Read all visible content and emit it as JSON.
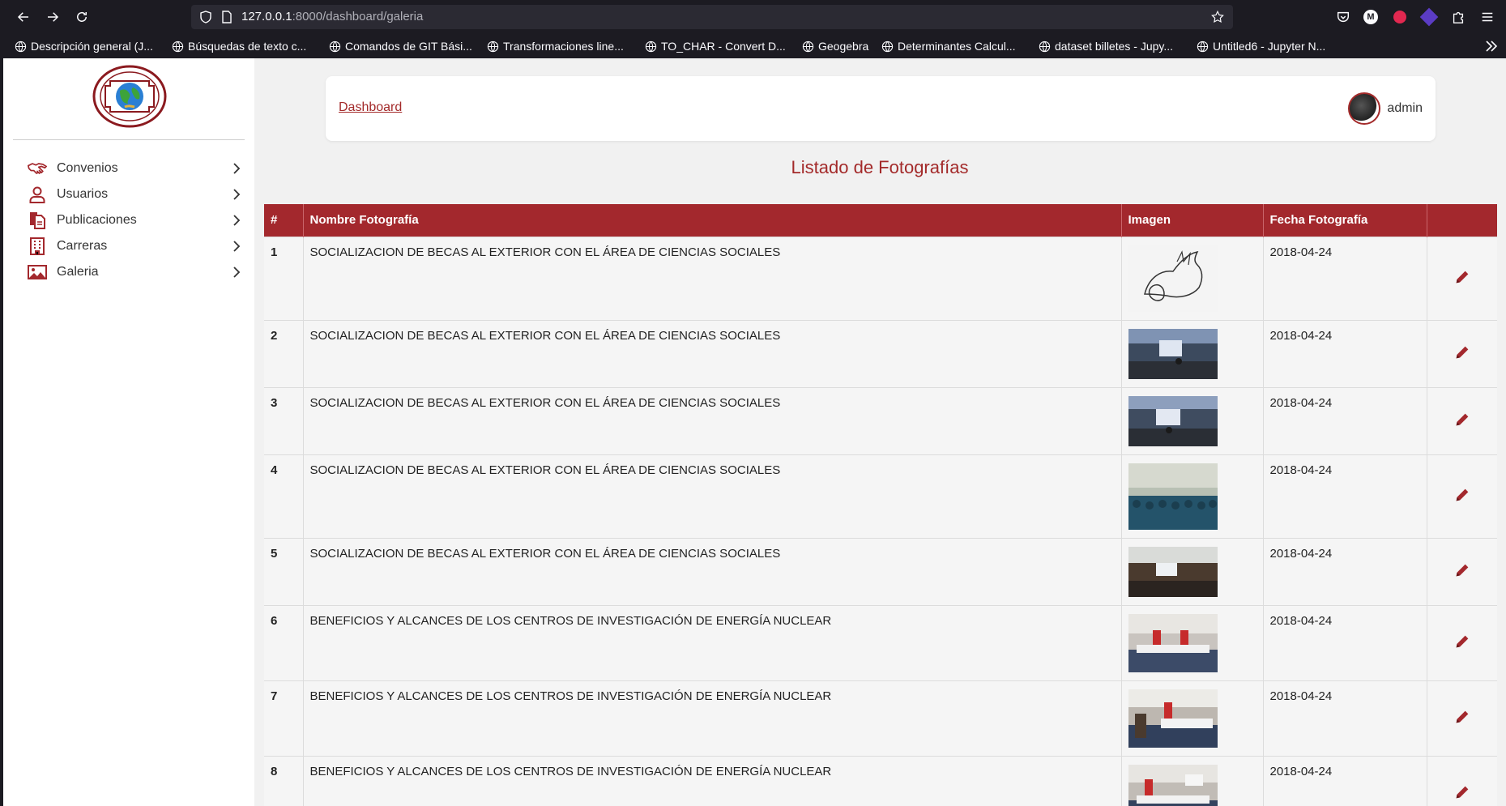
{
  "browser": {
    "url_host": "127.0.0.1",
    "url_rest": ":8000/dashboard/galeria",
    "bookmarks": [
      "Descripción general (J...",
      "Búsquedas de texto c...",
      "Comandos de GIT Bási...",
      "Transformaciones line...",
      "TO_CHAR - Convert D...",
      "Geogebra",
      "Determinantes Calcul...",
      "dataset billetes - Jupy...",
      "Untitled6 - Jupyter N..."
    ],
    "ext_badge": "M"
  },
  "sidebar": {
    "items": [
      {
        "label": "Convenios",
        "icon": "handshake-icon"
      },
      {
        "label": "Usuarios",
        "icon": "user-icon"
      },
      {
        "label": "Publicaciones",
        "icon": "documents-icon"
      },
      {
        "label": "Carreras",
        "icon": "building-icon"
      },
      {
        "label": "Galeria",
        "icon": "image-icon"
      }
    ]
  },
  "header": {
    "breadcrumb": "Dashboard",
    "username": "admin"
  },
  "page": {
    "title": "Listado de Fotografías"
  },
  "table": {
    "headers": [
      "#",
      "Nombre Fotografía",
      "Imagen",
      "Fecha Fotografía",
      ""
    ],
    "rows": [
      {
        "num": "1",
        "name": "SOCIALIZACION DE BECAS AL EXTERIOR CON EL ÁREA DE CIENCIAS SOCIALES",
        "date": "2018-04-24",
        "img": "sketch"
      },
      {
        "num": "2",
        "name": "SOCIALIZACION DE BECAS AL EXTERIOR CON EL ÁREA DE CIENCIAS SOCIALES",
        "date": "2018-04-24",
        "img": "room"
      },
      {
        "num": "3",
        "name": "SOCIALIZACION DE BECAS AL EXTERIOR CON EL ÁREA DE CIENCIAS SOCIALES",
        "date": "2018-04-24",
        "img": "room"
      },
      {
        "num": "4",
        "name": "SOCIALIZACION DE BECAS AL EXTERIOR CON EL ÁREA DE CIENCIAS SOCIALES",
        "date": "2018-04-24",
        "img": "audience"
      },
      {
        "num": "5",
        "name": "SOCIALIZACION DE BECAS AL EXTERIOR CON EL ÁREA DE CIENCIAS SOCIALES",
        "date": "2018-04-24",
        "img": "dark"
      },
      {
        "num": "6",
        "name": "BENEFICIOS Y ALCANCES DE LOS CENTROS DE INVESTIGACIÓN DE ENERGÍA NUCLEAR",
        "date": "2018-04-24",
        "img": "conference"
      },
      {
        "num": "7",
        "name": "BENEFICIOS Y ALCANCES DE LOS CENTROS DE INVESTIGACIÓN DE ENERGÍA NUCLEAR",
        "date": "2018-04-24",
        "img": "conference"
      },
      {
        "num": "8",
        "name": "BENEFICIOS Y ALCANCES DE LOS CENTROS DE INVESTIGACIÓN DE ENERGÍA NUCLEAR",
        "date": "2018-04-24",
        "img": "conference"
      }
    ]
  },
  "colors": {
    "brand": "#a3282d",
    "title": "#a32a2a"
  }
}
